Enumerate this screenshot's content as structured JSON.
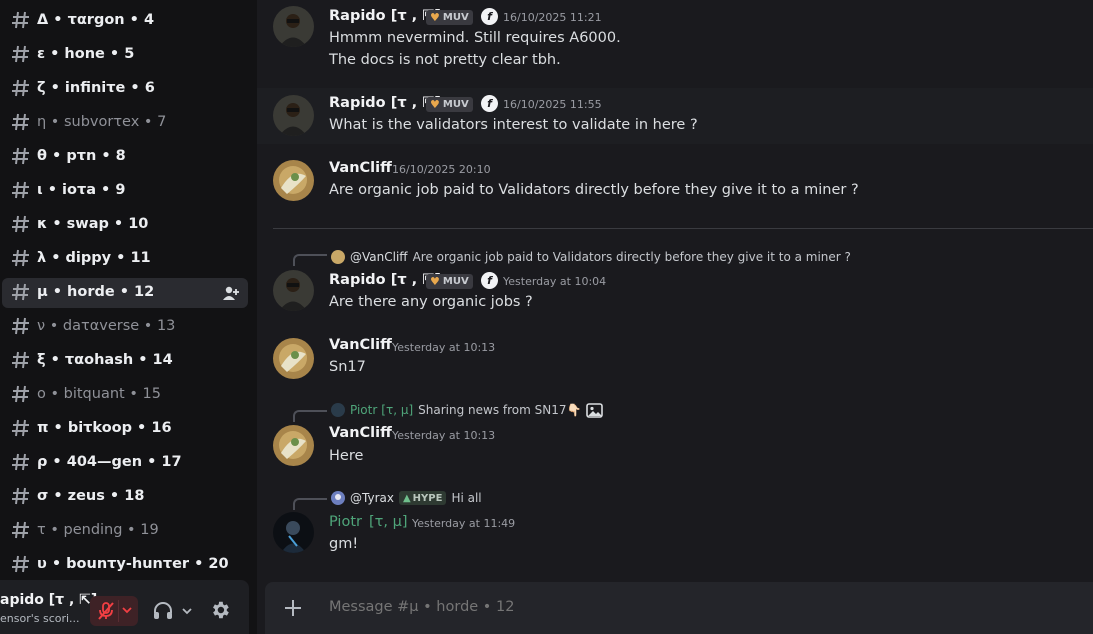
{
  "sidebar": {
    "channels": [
      {
        "label": "Δ • ταrgon • 4",
        "muted": false
      },
      {
        "label": "ε • hone • 5",
        "muted": false
      },
      {
        "label": "ζ • infiniτe • 6",
        "muted": false
      },
      {
        "label": "η • subvorτex • 7",
        "muted": true
      },
      {
        "label": "θ • pτn • 8",
        "muted": false
      },
      {
        "label": "ι • ioτa • 9",
        "muted": false
      },
      {
        "label": "κ • swap • 10",
        "muted": false
      },
      {
        "label": "λ • dippy • 11",
        "muted": false
      },
      {
        "label": "μ • horde • 12",
        "muted": false,
        "active": true
      },
      {
        "label": "ν • daταverse • 13",
        "muted": true
      },
      {
        "label": "ξ • ταohash • 14",
        "muted": false
      },
      {
        "label": "ο • bitquant • 15",
        "muted": true
      },
      {
        "label": "π • biτkoop • 16",
        "muted": false
      },
      {
        "label": "ρ • 404—gen • 17",
        "muted": false
      },
      {
        "label": "σ • zeus • 18",
        "muted": false
      },
      {
        "label": "τ • pending • 19",
        "muted": true
      },
      {
        "label": "υ • bounτy-hunτer • 20",
        "muted": false
      }
    ],
    "user": {
      "name": "apido [τ , ⇱]",
      "status": "ensor's scori..."
    }
  },
  "messages": [
    {
      "author": "Rapido [τ , ⇱]",
      "badge": "MUV",
      "role_icon": "f",
      "timestamp": "16/10/2025 11:21",
      "lines": [
        "Hmmm nevermind. Still requires A6000.",
        "The docs is not pretty clear tbh."
      ]
    },
    {
      "author": "Rapido [τ , ⇱]",
      "badge": "MUV",
      "role_icon": "f",
      "timestamp": "16/10/2025 11:55",
      "lines": [
        "What is the validators interest to validate in here ?"
      ]
    },
    {
      "author": "VanCliff",
      "timestamp": "16/10/2025 20:10",
      "lines": [
        "Are organic job paid to Validators directly before they give it to a miner ?"
      ]
    },
    {
      "reply_to": {
        "name": "@VanCliff",
        "text": "Are organic job paid to Validators directly before they give it to a miner ?"
      },
      "author": "Rapido [τ , ⇱]",
      "badge": "MUV",
      "role_icon": "f",
      "timestamp": "Yesterday at 10:04",
      "lines": [
        "Are there any organic jobs ?"
      ]
    },
    {
      "author": "VanCliff",
      "timestamp": "Yesterday at 10:13",
      "lines": [
        "Sn17"
      ]
    },
    {
      "reply_to": {
        "name": "Piotr",
        "tag": "[τ, μ]",
        "text": "Sharing news from SN17👇🏻"
      },
      "author": "VanCliff",
      "timestamp": "Yesterday at 10:13",
      "lines": [
        "Here"
      ]
    },
    {
      "reply_to": {
        "name": "@Tyrax",
        "badge": "HYPE",
        "text": "Hi all"
      },
      "author": "Piotr",
      "author_tag": "[τ, μ]",
      "timestamp": "Yesterday at 11:49",
      "lines": [
        "gm!"
      ]
    }
  ],
  "composer": {
    "placeholder": "Message #μ • horde • 12"
  },
  "colors": {
    "sidebar_bg": "#121214",
    "chat_bg": "#1a1a1e",
    "piotr_green": "#4fa57a",
    "badge_heart": "#e9a84d"
  },
  "icons": [
    "hashtag-icon",
    "add-user-icon",
    "mic-muted-icon",
    "headset-icon",
    "gear-icon",
    "plus-icon",
    "image-icon"
  ]
}
